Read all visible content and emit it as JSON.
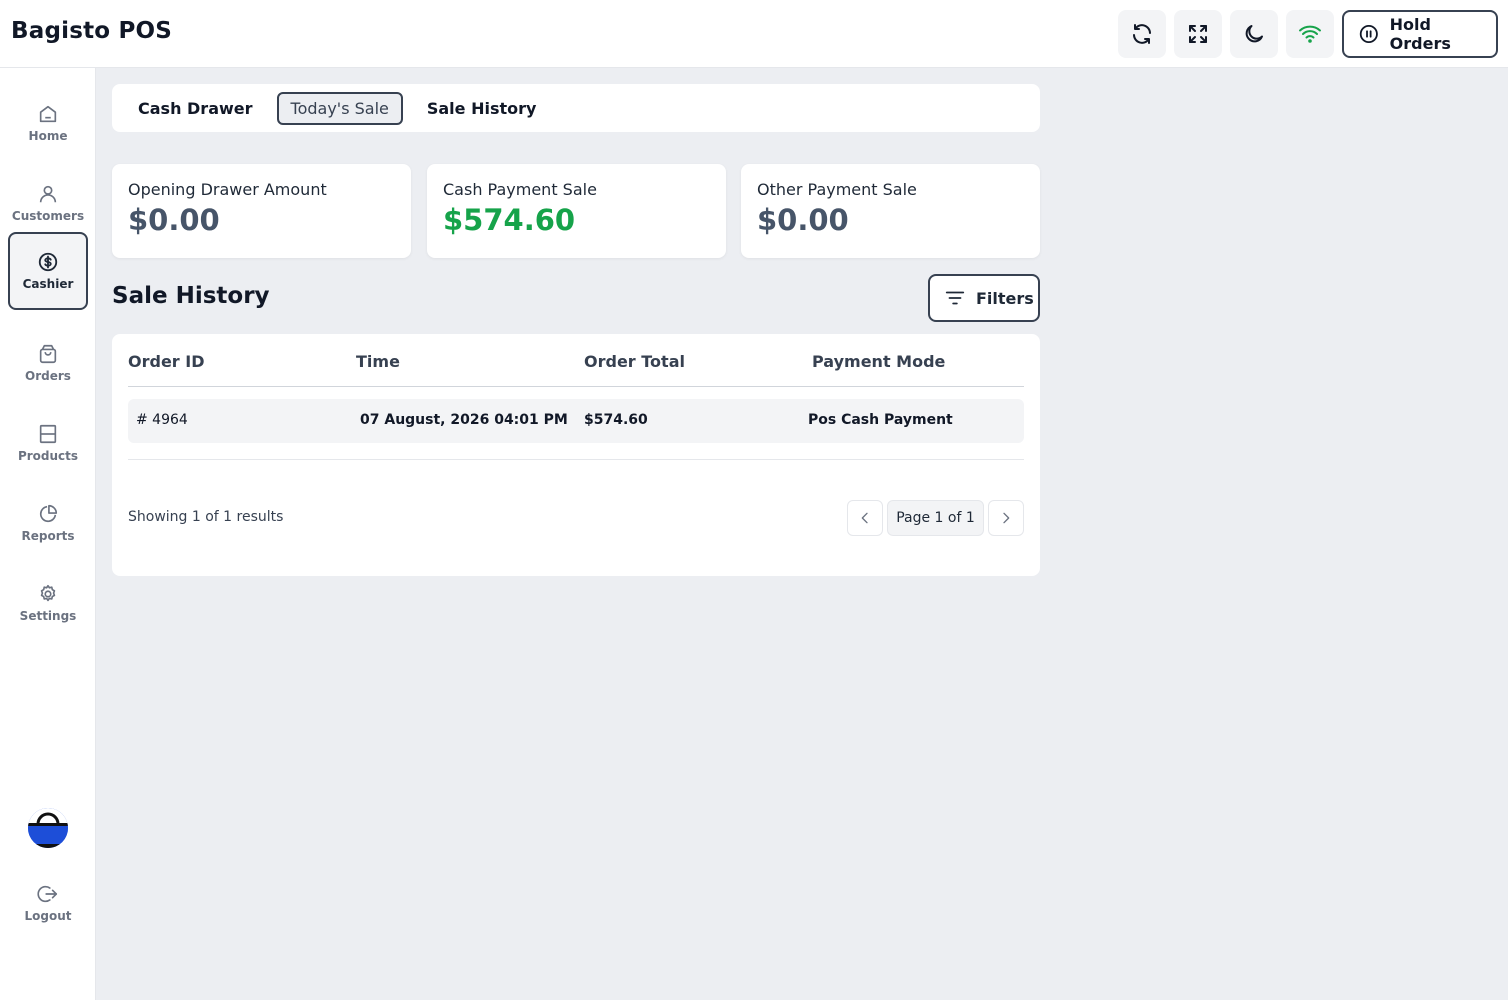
{
  "app": {
    "title": "Bagisto POS"
  },
  "header": {
    "hold_orders_label": "Hold Orders",
    "icons": [
      "refresh-icon",
      "fullscreen-icon",
      "moon-icon",
      "wifi-icon"
    ],
    "wifi_color": "#16a34a"
  },
  "sidebar": {
    "items": [
      {
        "label": "Home",
        "icon": "home-icon"
      },
      {
        "label": "Customers",
        "icon": "user-icon"
      },
      {
        "label": "Cashier",
        "icon": "dollar-circle-icon",
        "active": true
      },
      {
        "label": "Orders",
        "icon": "shopping-bag-icon"
      },
      {
        "label": "Products",
        "icon": "box-icon"
      },
      {
        "label": "Reports",
        "icon": "pie-chart-icon"
      },
      {
        "label": "Settings",
        "icon": "gear-icon"
      }
    ],
    "logout_label": "Logout"
  },
  "tabs": [
    "Cash Drawer",
    "Today's Sale",
    "Sale History"
  ],
  "stats": [
    {
      "title": "Opening Drawer Amount",
      "value": "$0.00"
    },
    {
      "title": "Cash Payment Sale",
      "value": "$574.60",
      "color": "#16a34a"
    },
    {
      "title": "Other Payment Sale",
      "value": "$0.00"
    }
  ],
  "sale_history": {
    "title": "Sale History",
    "filters_label": "Filters",
    "columns": [
      "Order ID",
      "Time",
      "Order Total",
      "Payment Mode"
    ],
    "rows": [
      {
        "order_id": "# 4964",
        "time": "07 August, 2026 04:01 PM",
        "total": "$574.60",
        "payment_mode": "Pos Cash Payment"
      }
    ],
    "showing_text": "Showing 1 of 1 results",
    "page_label": "Page 1 of 1"
  }
}
